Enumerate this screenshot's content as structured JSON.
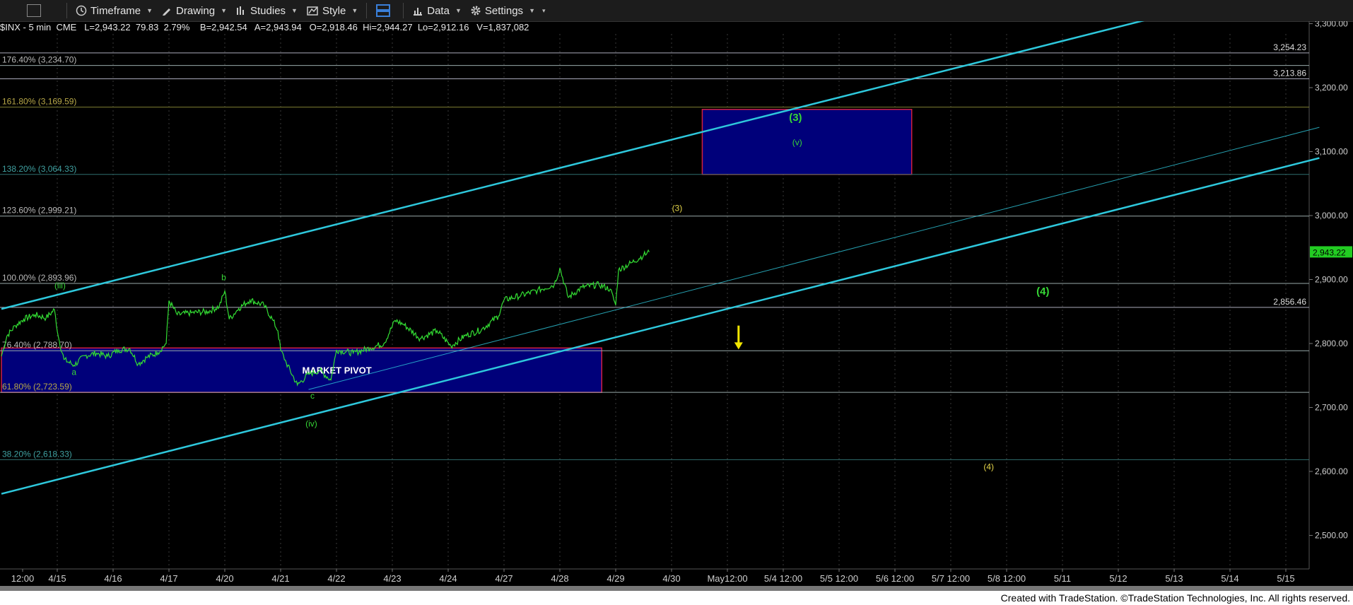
{
  "toolbar": {
    "timeframe": "Timeframe",
    "drawing": "Drawing",
    "studies": "Studies",
    "style": "Style",
    "data": "Data",
    "settings": "Settings"
  },
  "infobar": "$INX - 5 min  CME   L=2,943.22  79.83  2.79%    B=2,942.54   A=2,943.94   O=2,918.46  Hi=2,944.27  Lo=2,912.16   V=1,837,082",
  "footer": "Created with TradeStation. ©TradeStation Technologies, Inc. All rights reserved.",
  "colors": {
    "background": "#000000",
    "price": "#33dd33",
    "channel": "#2ec8dc",
    "pivot_box": "#00007a",
    "box_border": "#d02040",
    "fib_text": "#b9b9b9",
    "label_green": "#36d636",
    "label_yellow": "#e6d64a"
  },
  "chart_data": {
    "type": "line",
    "title": "",
    "series": [
      {
        "name": "$INX - 5 min"
      }
    ],
    "ylim": [
      2480,
      3320
    ],
    "yticks": [
      {
        "value": 2500,
        "label": "2,500.00"
      },
      {
        "value": 2600,
        "label": "2,600.00"
      },
      {
        "value": 2700,
        "label": "2,700.00"
      },
      {
        "value": 2800,
        "label": "2,800.00"
      },
      {
        "value": 2900,
        "label": "2,900.00"
      },
      {
        "value": 3000,
        "label": "3,000.00"
      },
      {
        "value": 3100,
        "label": "3,100.00"
      },
      {
        "value": 3200,
        "label": "3,200.00"
      },
      {
        "value": 3300,
        "label": "3,300.00"
      }
    ],
    "xlim": [
      0,
      23.6
    ],
    "xticks": [
      {
        "value": 0.3,
        "label": "12:00"
      },
      {
        "value": 1,
        "label": "4/15"
      },
      {
        "value": 2,
        "label": "4/16"
      },
      {
        "value": 3,
        "label": "4/17"
      },
      {
        "value": 4,
        "label": "4/20"
      },
      {
        "value": 5,
        "label": "4/21"
      },
      {
        "value": 6,
        "label": "4/22"
      },
      {
        "value": 7,
        "label": "4/23"
      },
      {
        "value": 8,
        "label": "4/24"
      },
      {
        "value": 9,
        "label": "4/27"
      },
      {
        "value": 10,
        "label": "4/28"
      },
      {
        "value": 11,
        "label": "4/29"
      },
      {
        "value": 12,
        "label": "4/30"
      },
      {
        "value": 13,
        "label": "May12:00"
      },
      {
        "value": 14,
        "label": "5/4 12:00"
      },
      {
        "value": 15,
        "label": "5/5 12:00"
      },
      {
        "value": 16,
        "label": "5/6 12:00"
      },
      {
        "value": 17,
        "label": "5/7 12:00"
      },
      {
        "value": 18,
        "label": "5/8 12:00"
      },
      {
        "value": 19,
        "label": "5/11"
      },
      {
        "value": 20,
        "label": "5/12"
      },
      {
        "value": 21,
        "label": "5/13"
      },
      {
        "value": 22,
        "label": "5/14"
      },
      {
        "value": 23,
        "label": "5/15"
      }
    ],
    "last_price": {
      "value": 2943.22,
      "label": "2,943.22"
    },
    "price_path": [
      [
        0.0,
        2780
      ],
      [
        0.1,
        2812
      ],
      [
        0.25,
        2828
      ],
      [
        0.4,
        2838
      ],
      [
        0.6,
        2845
      ],
      [
        0.8,
        2840
      ],
      [
        0.95,
        2853
      ],
      [
        1.02,
        2810
      ],
      [
        1.12,
        2775
      ],
      [
        1.3,
        2766
      ],
      [
        1.5,
        2781
      ],
      [
        1.7,
        2785
      ],
      [
        1.9,
        2780
      ],
      [
        2.1,
        2790
      ],
      [
        2.3,
        2792
      ],
      [
        2.45,
        2768
      ],
      [
        2.6,
        2778
      ],
      [
        2.8,
        2786
      ],
      [
        2.95,
        2800
      ],
      [
        3.0,
        2867
      ],
      [
        3.15,
        2845
      ],
      [
        3.4,
        2848
      ],
      [
        3.7,
        2850
      ],
      [
        3.9,
        2858
      ],
      [
        4.0,
        2882
      ],
      [
        4.08,
        2838
      ],
      [
        4.25,
        2855
      ],
      [
        4.45,
        2868
      ],
      [
        4.7,
        2860
      ],
      [
        4.85,
        2838
      ],
      [
        4.95,
        2820
      ],
      [
        5.0,
        2790
      ],
      [
        5.1,
        2770
      ],
      [
        5.3,
        2735
      ],
      [
        5.5,
        2752
      ],
      [
        5.7,
        2758
      ],
      [
        5.9,
        2743
      ],
      [
        6.0,
        2790
      ],
      [
        6.3,
        2785
      ],
      [
        6.6,
        2793
      ],
      [
        6.85,
        2800
      ],
      [
        7.05,
        2836
      ],
      [
        7.2,
        2830
      ],
      [
        7.5,
        2808
      ],
      [
        7.8,
        2820
      ],
      [
        8.05,
        2796
      ],
      [
        8.3,
        2812
      ],
      [
        8.6,
        2822
      ],
      [
        8.9,
        2843
      ],
      [
        9.0,
        2868
      ],
      [
        9.3,
        2875
      ],
      [
        9.6,
        2883
      ],
      [
        9.9,
        2892
      ],
      [
        10.0,
        2918
      ],
      [
        10.15,
        2872
      ],
      [
        10.4,
        2888
      ],
      [
        10.7,
        2892
      ],
      [
        10.9,
        2885
      ],
      [
        11.0,
        2860
      ],
      [
        11.05,
        2915
      ],
      [
        11.3,
        2927
      ],
      [
        11.5,
        2938
      ],
      [
        11.6,
        2943
      ]
    ],
    "fib_levels": [
      {
        "label": "176.40% (3,234.70)",
        "value": 3234.7
      },
      {
        "label": "161.80% (3,169.59)",
        "value": 3169.59
      },
      {
        "label": "138.20% (3,064.33)",
        "value": 3064.33
      },
      {
        "label": "123.60% (2,999.21)",
        "value": 2999.21
      },
      {
        "label": "100.00% (2,893.96)",
        "value": 2893.96
      },
      {
        "label": "76.40% (2,788.70)",
        "value": 2788.7
      },
      {
        "label": "61.80% (2,723.59)",
        "value": 2723.59
      },
      {
        "label": "38.20% (2,618.33)",
        "value": 2618.33
      }
    ],
    "price_levels": [
      {
        "label": "3,254.23",
        "value": 3254.23
      },
      {
        "label": "3,213.86",
        "value": 3213.86
      },
      {
        "label": "2,856.46",
        "value": 2856.46
      }
    ],
    "channel_lines": [
      {
        "from": [
          0,
          2854
        ],
        "to": [
          21,
          3317
        ],
        "weight": "thick"
      },
      {
        "from": [
          0,
          2565
        ],
        "to": [
          23.6,
          3090
        ],
        "weight": "thick"
      },
      {
        "from": [
          5.5,
          2728
        ],
        "to": [
          23.6,
          3138
        ],
        "weight": "thin"
      }
    ],
    "boxes": [
      {
        "label": "MARKET PIVOT",
        "x": [
          0,
          10.75
        ],
        "y": [
          2723.59,
          2793
        ]
      },
      {
        "label": "",
        "x": [
          12.55,
          16.3
        ],
        "y": [
          3064.33,
          3166
        ]
      }
    ],
    "wave_labels": [
      {
        "text": "(iii)",
        "x": 1.05,
        "y": 2886,
        "color": "green"
      },
      {
        "text": "a",
        "x": 1.3,
        "y": 2751,
        "color": "green"
      },
      {
        "text": "b",
        "x": 3.98,
        "y": 2899,
        "color": "green"
      },
      {
        "text": "c",
        "x": 5.57,
        "y": 2714,
        "color": "green"
      },
      {
        "text": "(iv)",
        "x": 5.55,
        "y": 2670,
        "color": "green"
      },
      {
        "text": "(3)",
        "x": 14.22,
        "y": 3148,
        "color": "green"
      },
      {
        "text": "(v)",
        "x": 14.25,
        "y": 3110,
        "color": "green"
      },
      {
        "text": "(3)",
        "x": 12.1,
        "y": 3007,
        "color": "yellow"
      },
      {
        "text": "(4)",
        "x": 18.65,
        "y": 2876,
        "color": "green"
      },
      {
        "text": "(4)",
        "x": 17.68,
        "y": 2603,
        "color": "yellow"
      }
    ],
    "arrow": {
      "direction": "down",
      "x": 13.2,
      "y": [
        2828,
        2793
      ]
    }
  }
}
